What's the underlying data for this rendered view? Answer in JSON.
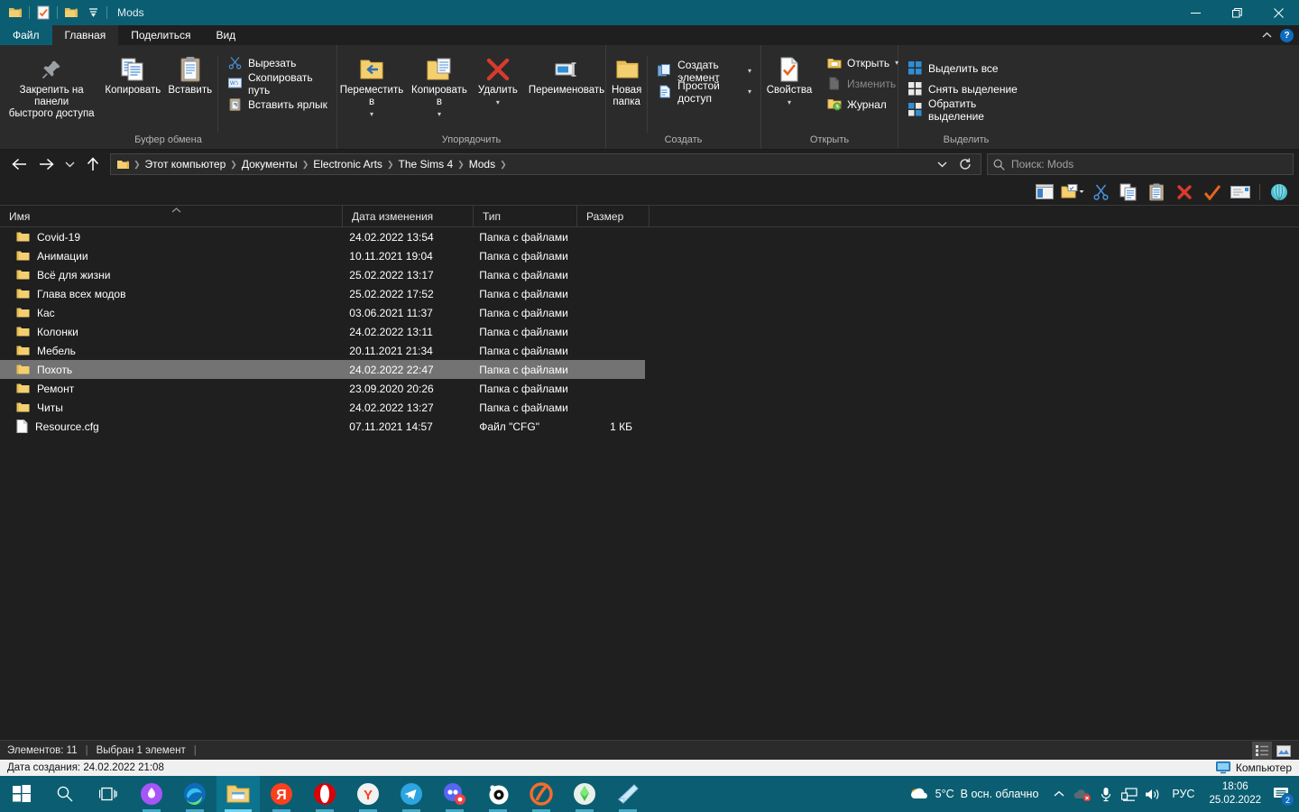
{
  "window": {
    "title": "Mods",
    "quick_access": [
      "folder-icon",
      "properties-checkmark-icon",
      "folder-icon",
      "customize-chevron-icon"
    ],
    "minimize_label": "—",
    "maximize_label": "❐",
    "close_label": "✕"
  },
  "ribbon": {
    "tabs": [
      {
        "label": "Файл",
        "kind": "file"
      },
      {
        "label": "Главная",
        "kind": "active"
      },
      {
        "label": "Поделиться",
        "kind": "normal"
      },
      {
        "label": "Вид",
        "kind": "normal"
      }
    ],
    "collapse_icon": "chevron-up-icon",
    "help_label": "?",
    "groups": [
      {
        "name": "Буфер обмена",
        "big": [
          {
            "label": "Закрепить на панели\nбыстрого доступа",
            "icon": "pin-icon"
          },
          {
            "label": "Копировать",
            "icon": "copy-icon"
          },
          {
            "label": "Вставить",
            "icon": "paste-icon"
          }
        ],
        "small": [
          {
            "label": "Вырезать",
            "icon": "scissors-icon",
            "disabled": false
          },
          {
            "label": "Скопировать путь",
            "icon": "copy-path-icon",
            "disabled": false
          },
          {
            "label": "Вставить ярлык",
            "icon": "paste-shortcut-icon",
            "disabled": false
          }
        ]
      },
      {
        "name": "Упорядочить",
        "big": [
          {
            "label": "Переместить\nв",
            "icon": "move-to-icon",
            "caret": true
          },
          {
            "label": "Копировать\nв",
            "icon": "copy-to-icon",
            "caret": true
          },
          {
            "label": "Удалить",
            "icon": "delete-x-icon",
            "caret": true
          },
          {
            "label": "Переименовать",
            "icon": "rename-icon",
            "caret": false
          }
        ],
        "small": []
      },
      {
        "name": "Создать",
        "big": [
          {
            "label": "Новая\nпапка",
            "icon": "new-folder-icon"
          }
        ],
        "small": [
          {
            "label": "Создать элемент",
            "icon": "new-item-icon",
            "caret": true
          },
          {
            "label": "Простой доступ",
            "icon": "easy-access-icon",
            "caret": true
          }
        ]
      },
      {
        "name": "Открыть",
        "big": [
          {
            "label": "Свойства",
            "icon": "properties-icon",
            "caret": true
          }
        ],
        "small": [
          {
            "label": "Открыть",
            "icon": "open-folder-icon",
            "caret": true,
            "disabled": false
          },
          {
            "label": "Изменить",
            "icon": "edit-icon",
            "disabled": true
          },
          {
            "label": "Журнал",
            "icon": "history-icon",
            "disabled": false
          }
        ]
      },
      {
        "name": "Выделить",
        "big": [],
        "small": [
          {
            "label": "Выделить все",
            "icon": "select-all-icon"
          },
          {
            "label": "Снять выделение",
            "icon": "select-none-icon"
          },
          {
            "label": "Обратить выделение",
            "icon": "invert-selection-icon"
          }
        ]
      }
    ]
  },
  "address": {
    "back_icon": "arrow-left-icon",
    "forward_icon": "arrow-right-icon",
    "recent_icon": "chevron-down-icon",
    "up_icon": "arrow-up-icon",
    "breadcrumb": [
      "Этот компьютер",
      "Документы",
      "Electronic Arts",
      "The Sims 4",
      "Mods"
    ],
    "dropdown_icon": "chevron-down-icon",
    "refresh_icon": "refresh-icon",
    "search_placeholder": "Поиск: Mods",
    "search_value": ""
  },
  "toolbar2": {
    "buttons": [
      "preview-pane-icon",
      "new-folder-dropdown-icon",
      "cut-icon",
      "copy-icon",
      "paste-icon",
      "delete-icon",
      "properties-check-icon",
      "rename-icon",
      "shell-icon"
    ]
  },
  "columns": [
    {
      "label": "Имя",
      "key": "name"
    },
    {
      "label": "Дата изменения",
      "key": "date"
    },
    {
      "label": "Тип",
      "key": "type"
    },
    {
      "label": "Размер",
      "key": "size"
    }
  ],
  "sort": {
    "column": "Имя",
    "direction": "asc",
    "icon": "caret-up-icon"
  },
  "files": [
    {
      "name": "Covid-19",
      "date": "24.02.2022 13:54",
      "type": "Папка с файлами",
      "size": "",
      "icon": "folder-icon",
      "selected": false
    },
    {
      "name": "Анимации",
      "date": "10.11.2021 19:04",
      "type": "Папка с файлами",
      "size": "",
      "icon": "folder-icon",
      "selected": false
    },
    {
      "name": "Всё для жизни",
      "date": "25.02.2022 13:17",
      "type": "Папка с файлами",
      "size": "",
      "icon": "folder-icon",
      "selected": false
    },
    {
      "name": "Глава всех модов",
      "date": "25.02.2022 17:52",
      "type": "Папка с файлами",
      "size": "",
      "icon": "folder-icon",
      "selected": false
    },
    {
      "name": "Кас",
      "date": "03.06.2021 11:37",
      "type": "Папка с файлами",
      "size": "",
      "icon": "folder-icon",
      "selected": false
    },
    {
      "name": "Колонки",
      "date": "24.02.2022 13:11",
      "type": "Папка с файлами",
      "size": "",
      "icon": "folder-icon",
      "selected": false
    },
    {
      "name": "Мебель",
      "date": "20.11.2021 21:34",
      "type": "Папка с файлами",
      "size": "",
      "icon": "folder-icon",
      "selected": false
    },
    {
      "name": "Похоть",
      "date": "24.02.2022 22:47",
      "type": "Папка с файлами",
      "size": "",
      "icon": "folder-icon",
      "selected": true
    },
    {
      "name": "Ремонт",
      "date": "23.09.2020 20:26",
      "type": "Папка с файлами",
      "size": "",
      "icon": "folder-icon",
      "selected": false
    },
    {
      "name": "Читы",
      "date": "24.02.2022 13:27",
      "type": "Папка с файлами",
      "size": "",
      "icon": "folder-icon",
      "selected": false
    },
    {
      "name": "Resource.cfg",
      "date": "07.11.2021 14:57",
      "type": "Файл \"CFG\"",
      "size": "1 КБ",
      "icon": "file-icon",
      "selected": false
    }
  ],
  "status": {
    "items_count": "Элементов: 11",
    "selection": "Выбран 1 элемент",
    "view_details_icon": "details-view-icon",
    "view_tiles_icon": "large-icons-view-icon"
  },
  "tooltip": {
    "text": "Дата создания: 24.02.2022 21:08",
    "computer_label": "Компьютер",
    "computer_icon": "monitor-icon"
  },
  "taskbar": {
    "start_icon": "windows-start-icon",
    "search_icon": "search-icon",
    "taskview_icon": "task-view-icon",
    "apps": [
      {
        "name": "cortana-app",
        "icon": "purple-circle-icon",
        "state": "open"
      },
      {
        "name": "edge-app",
        "icon": "edge-icon",
        "state": "open"
      },
      {
        "name": "file-explorer-app",
        "icon": "folder-icon",
        "state": "active"
      },
      {
        "name": "yandex-browser-app",
        "icon": "yandex-ya-icon",
        "state": "open"
      },
      {
        "name": "opera-app",
        "icon": "opera-o-icon",
        "state": "open"
      },
      {
        "name": "yandex-app",
        "icon": "yandex-y-icon",
        "state": "open"
      },
      {
        "name": "telegram-app",
        "icon": "telegram-icon",
        "state": "open"
      },
      {
        "name": "discord-app",
        "icon": "discord-icon",
        "state": "open"
      },
      {
        "name": "steelseries-app",
        "icon": "steelseries-icon",
        "state": "open"
      },
      {
        "name": "origin-app",
        "icon": "origin-icon",
        "state": "open"
      },
      {
        "name": "sims4-app",
        "icon": "sims-plumbob-icon",
        "state": "open"
      },
      {
        "name": "notepad-app",
        "icon": "notepad-icon",
        "state": "open"
      }
    ],
    "tray": {
      "weather_temp": "5°C",
      "weather_text": "В осн. облачно",
      "weather_icon": "cloud-icon",
      "overflow_icon": "chevron-up-icon",
      "icons": [
        "onedrive-error-icon",
        "microphone-icon",
        "network-icon",
        "volume-icon"
      ],
      "language": "РУС",
      "time": "18:06",
      "date": "25.02.2022",
      "notification_icon": "notification-icon",
      "notification_count": "2"
    }
  }
}
